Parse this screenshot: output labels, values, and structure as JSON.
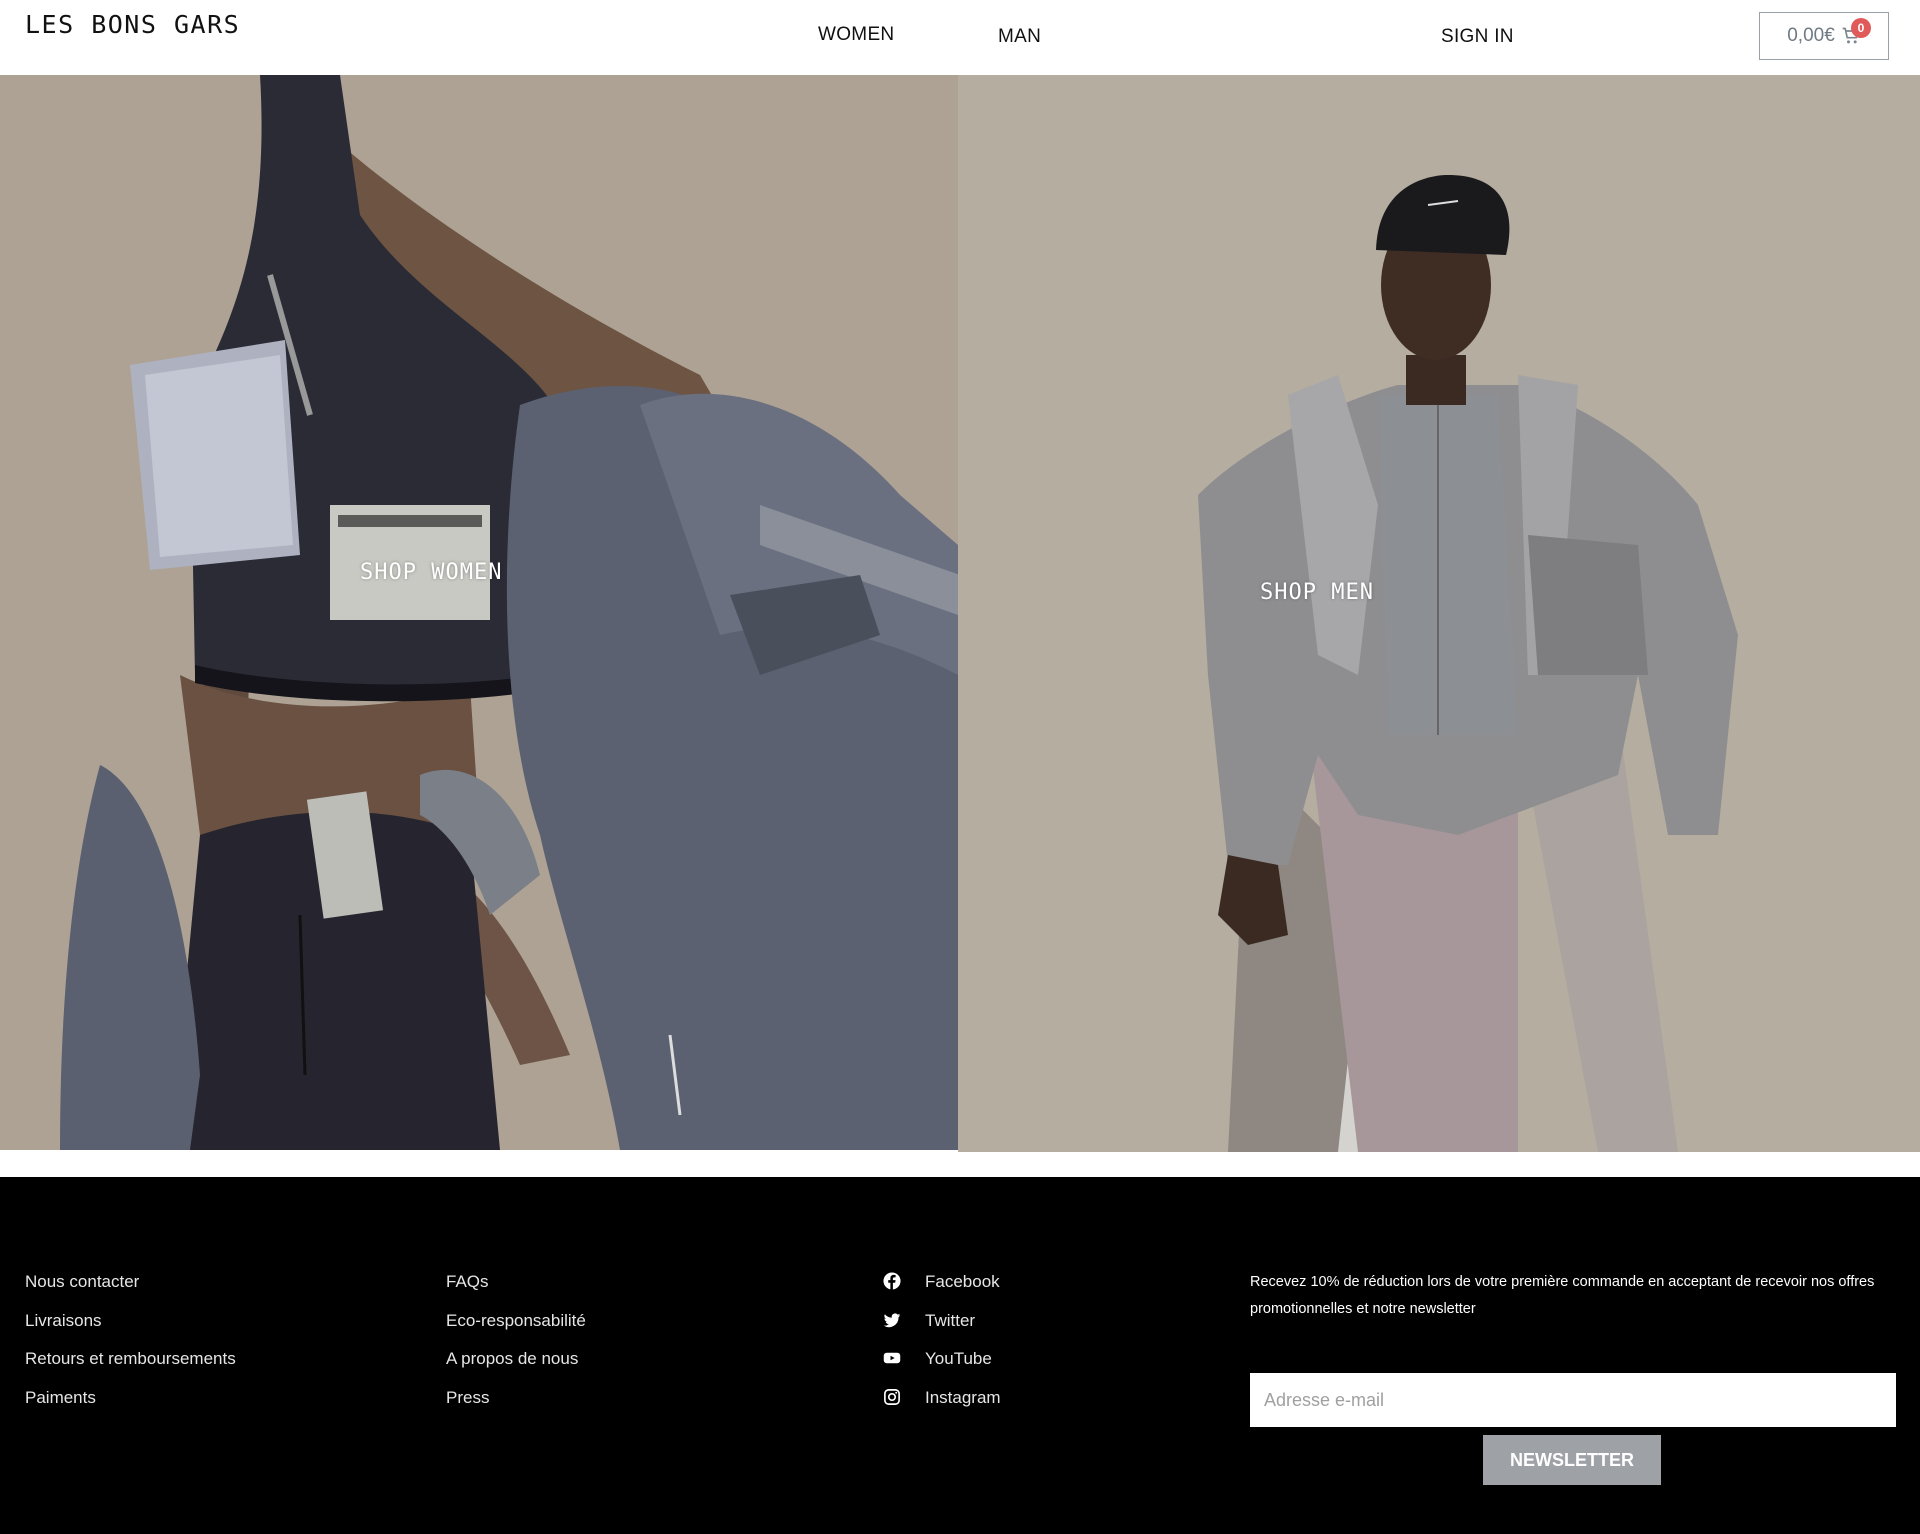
{
  "header": {
    "logo": "LES BONS GARS",
    "nav": {
      "women": "WOMEN",
      "man": "MAN"
    },
    "sign_in": "SIGN IN",
    "cart": {
      "amount": "0,00€",
      "count": "0",
      "icon": "cart-icon"
    }
  },
  "hero": {
    "women_label": "SHOP WOMEN",
    "men_label": "SHOP MEN",
    "colors": {
      "women_bg": "#ada293",
      "men_bg": "#b4ada0"
    }
  },
  "footer": {
    "col1": [
      "Nous contacter",
      "Livraisons",
      "Retours et remboursements",
      "Paiments"
    ],
    "col2": [
      "FAQs",
      "Eco-responsabilité",
      "A propos de nous",
      "Press"
    ],
    "social": [
      {
        "label": "Facebook",
        "icon": "facebook-icon"
      },
      {
        "label": "Twitter",
        "icon": "twitter-icon"
      },
      {
        "label": "YouTube",
        "icon": "youtube-icon"
      },
      {
        "label": "Instagram",
        "icon": "instagram-icon"
      }
    ],
    "newsletter": {
      "text": "Recevez 10% de réduction lors de votre première commande en acceptant de recevoir nos offres promotionnelles et notre newsletter",
      "placeholder": "Adresse e-mail",
      "button": "NEWSLETTER"
    }
  }
}
